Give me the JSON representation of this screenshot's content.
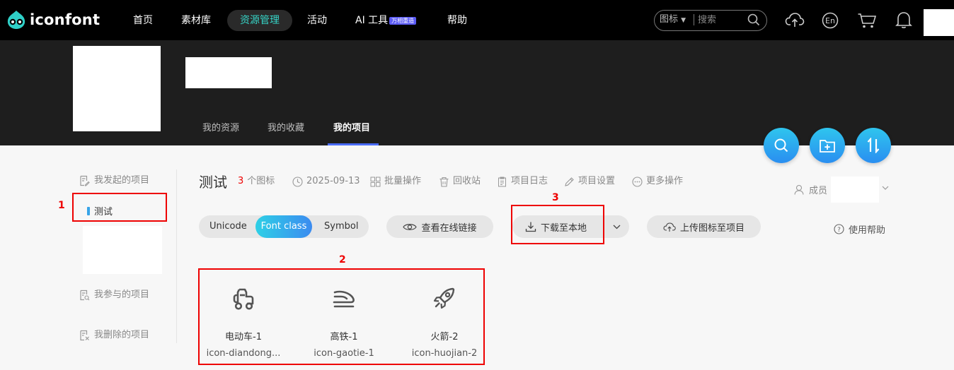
{
  "nav": {
    "brand": "iconfont",
    "items": [
      "首页",
      "素材库",
      "资源管理",
      "活动",
      "AI 工具",
      "帮助"
    ],
    "active": "资源管理",
    "ai_badge": "万相重造",
    "search_category": "图标",
    "search_placeholder": "搜索",
    "lang_label": "En"
  },
  "profile_tabs": [
    "我的资源",
    "我的收藏",
    "我的项目"
  ],
  "sidebar": {
    "initiated": "我发起的项目",
    "selected_project": "测试",
    "participated": "我参与的项目",
    "deleted": "我删除的项目"
  },
  "project": {
    "name": "测试",
    "icon_count": "3",
    "icon_count_suffix": "个图标",
    "date": "2025-09-13",
    "actions": [
      "批量操作",
      "回收站",
      "项目日志",
      "项目设置",
      "更多操作"
    ],
    "members_label": "成员"
  },
  "toolbar": {
    "formats": [
      "Unicode",
      "Font class",
      "Symbol"
    ],
    "active_format": "Font class",
    "view_online": "查看在线链接",
    "download": "下载至本地",
    "upload": "上传图标至项目",
    "help": "使用帮助"
  },
  "icons": [
    {
      "name": "电动车-1",
      "code": "icon-diandong..."
    },
    {
      "name": "高铁-1",
      "code": "icon-gaotie-1"
    },
    {
      "name": "火箭-2",
      "code": "icon-huojian-2"
    }
  ],
  "annotations": [
    "1",
    "2",
    "3"
  ],
  "colors": {
    "accent_teal": "#36d4c7",
    "accent_blue": "#3b8bf0",
    "annotation_red": "#e00000"
  }
}
